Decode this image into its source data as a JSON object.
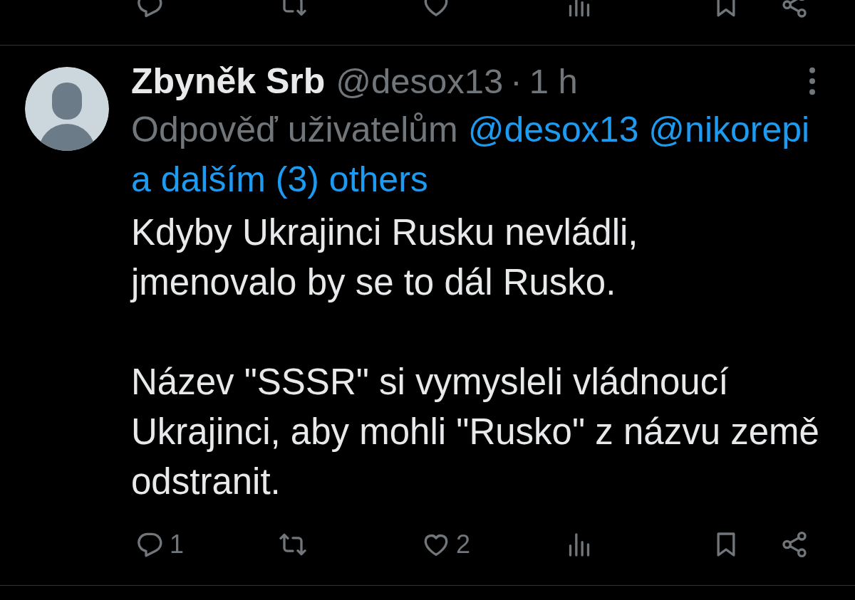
{
  "previous_post": {
    "actions": [
      {
        "kind": "reply"
      },
      {
        "kind": "repost"
      },
      {
        "kind": "like"
      },
      {
        "kind": "views"
      },
      {
        "kind": "bookmark"
      },
      {
        "kind": "share"
      }
    ]
  },
  "post": {
    "author": {
      "name": "Zbyněk Srb",
      "handle": "@desox13"
    },
    "separator": "·",
    "time": "1 h",
    "reply_to": {
      "prefix": "Odpověď uživatelům",
      "mentions": [
        "@desox13",
        "@nikorepi"
      ],
      "others": "a dalším (3) others"
    },
    "paragraphs": [
      "Kdyby Ukrajinci Rusku nevládli,\njmenovalo by se to dál Rusko.",
      "Název \"SSSR\" si vymysleli vládnoucí Ukrajinci, aby mohli \"Rusko\" z názvu země odstranit."
    ],
    "actions": [
      {
        "kind": "reply",
        "count": "1"
      },
      {
        "kind": "repost"
      },
      {
        "kind": "like",
        "count": "2"
      },
      {
        "kind": "views"
      },
      {
        "kind": "bookmark"
      },
      {
        "kind": "share"
      }
    ]
  }
}
